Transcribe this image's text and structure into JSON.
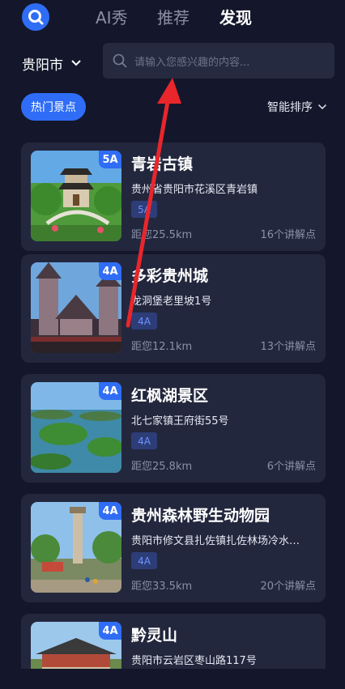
{
  "header": {
    "logo_icon": "search-logo-icon",
    "tabs": [
      {
        "label": "AI秀",
        "active": false
      },
      {
        "label": "推荐",
        "active": false
      },
      {
        "label": "发现",
        "active": true
      }
    ]
  },
  "filters": {
    "city": "贵阳市",
    "search_placeholder": "请输入您感兴趣的内容...",
    "category_chip": "热门景点",
    "sort_label": "智能排序"
  },
  "colors": {
    "background": "#14172b",
    "card": "#23273d",
    "accent": "#2f6df6",
    "annotation_arrow": "#e8262c"
  },
  "spots": [
    {
      "name": "青岩古镇",
      "address": "贵州省贵阳市花溪区青岩镇",
      "level": "5A",
      "distance": "距您25.5km",
      "points": "16个讲解点"
    },
    {
      "name": "多彩贵州城",
      "address": "龙洞堡老里坡1号",
      "level": "4A",
      "distance": "距您12.1km",
      "points": "13个讲解点"
    },
    {
      "name": "红枫湖景区",
      "address": "北七家镇王府街55号",
      "level": "4A",
      "distance": "距您25.8km",
      "points": "6个讲解点"
    },
    {
      "name": "贵州森林野生动物园",
      "address": "贵阳市修文县扎佐镇扎佐林场冷水…",
      "level": "4A",
      "distance": "距您33.5km",
      "points": "20个讲解点"
    },
    {
      "name": "黔灵山",
      "address": "贵阳市云岩区枣山路117号",
      "level": "4A",
      "distance": "",
      "points": ""
    }
  ]
}
